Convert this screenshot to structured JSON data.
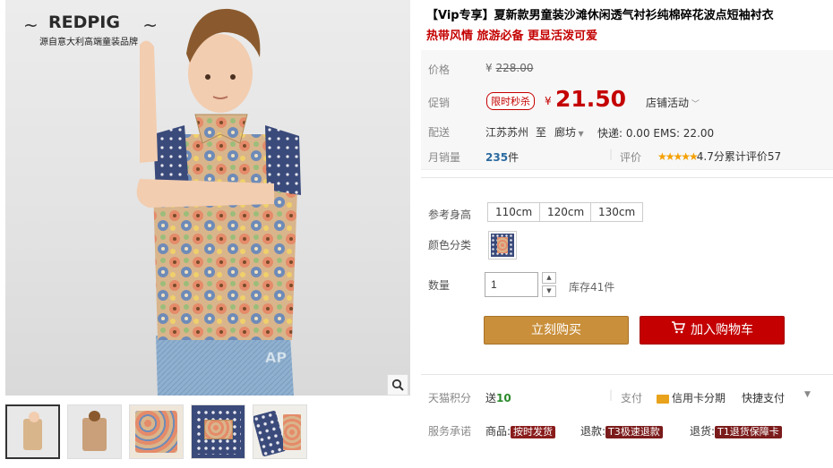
{
  "brand": {
    "name": "REDPIG",
    "tagline": "源自意大利高端童装品牌"
  },
  "product": {
    "title": "【Vip专享】夏新款男童装沙滩休闲透气衬衫纯棉碎花波点短袖衬衣",
    "subtitle": "热带风情 旅游必备 更显活泼可爱"
  },
  "pricing": {
    "price_label": "价格",
    "currency": "¥",
    "original_price": "228.00",
    "promo_label": "促销",
    "flash_tag": "限时秒杀",
    "promo_price": "21.50",
    "store_promo": "店铺活动",
    "shipping_label": "配送",
    "ship_from": "江苏苏州",
    "ship_to_word": "至",
    "ship_to": "廊坊",
    "shipping_fee": "快递: 0.00 EMS: 22.00",
    "monthly_sales_label": "月销量",
    "monthly_sales": "235",
    "sales_unit": "件",
    "rating_label": "评价",
    "rating_stars": "★★★★★",
    "rating_text": "4.7分累计评价57"
  },
  "options": {
    "height_label": "参考身高",
    "sizes": [
      "110cm",
      "120cm",
      "130cm"
    ],
    "color_label": "颜色分类",
    "qty_label": "数量",
    "qty_value": "1",
    "stock": "库存41件"
  },
  "actions": {
    "buy_now": "立刻购买",
    "add_to_cart": "加入购物车"
  },
  "footer": {
    "points_label": "天猫积分",
    "points_send": "送",
    "points_value": "10",
    "pay_label": "支付",
    "credit_installment": "信用卡分期",
    "quick_pay": "快捷支付",
    "service_label": "服务承诺",
    "goods_label": "商品:",
    "goods_badge": "按时发货",
    "refund_label": "退款:",
    "refund_badge": "T3极速退款",
    "return_label": "退货:",
    "return_badge": "T1退货保障卡"
  },
  "colors": {
    "accent_red": "#c40000",
    "buy_orange": "#c98f3a",
    "star_gold": "#f5a000"
  }
}
